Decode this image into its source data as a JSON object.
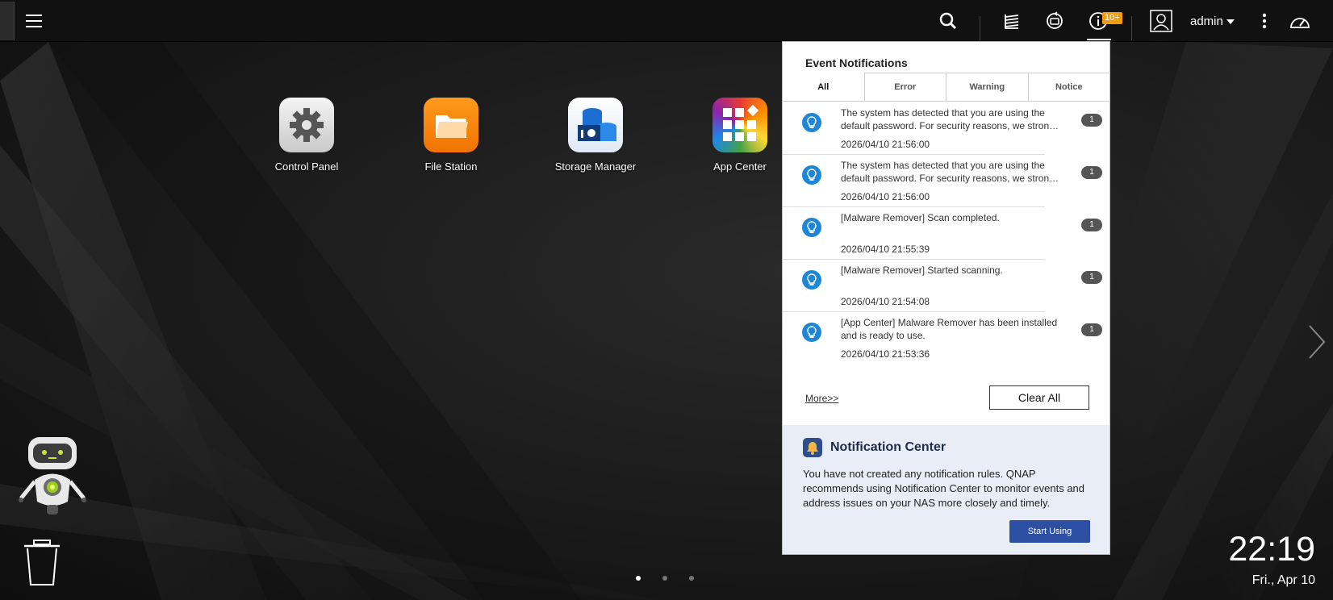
{
  "topbar": {
    "notification_badge": "10+",
    "user_name": "admin"
  },
  "desktop": {
    "apps": [
      {
        "label": "Control Panel"
      },
      {
        "label": "File Station"
      },
      {
        "label": "Storage Manager"
      },
      {
        "label": "App Center"
      }
    ]
  },
  "notifications": {
    "title": "Event Notifications",
    "tabs": [
      "All",
      "Error",
      "Warning",
      "Notice"
    ],
    "active_tab": "All",
    "items": [
      {
        "line1": "The system has detected that you are using the",
        "line2": "default password. For security reasons, we strongl...",
        "time": "2026/04/10 21:56:00",
        "count": "1"
      },
      {
        "line1": "The system has detected that you are using the",
        "line2": "default password. For security reasons, we strongl...",
        "time": "2026/04/10 21:56:00",
        "count": "1"
      },
      {
        "line1": "[Malware Remover] Scan completed.",
        "line2": "",
        "time": "2026/04/10 21:55:39",
        "count": "1"
      },
      {
        "line1": "[Malware Remover] Started scanning.",
        "line2": "",
        "time": "2026/04/10 21:54:08",
        "count": "1"
      },
      {
        "line1": "[App Center] Malware Remover has been installed",
        "line2": "and is ready to use.",
        "time": "2026/04/10 21:53:36",
        "count": "1"
      }
    ],
    "more_label": "More>>",
    "clear_label": "Clear All"
  },
  "notification_center": {
    "title": "Notification Center",
    "description": "You have not created any notification rules. QNAP recommends using Notification Center to monitor events and address issues on your NAS more closely and timely.",
    "button_label": "Start Using"
  },
  "clock": {
    "time": "22:19",
    "date": "Fri., Apr 10"
  },
  "pager": {
    "pages": 3,
    "active": 1
  },
  "colors": {
    "accent_blue": "#2d4fa3",
    "badge_orange": "#f39c12",
    "info_icon_blue": "#1d86d6"
  }
}
